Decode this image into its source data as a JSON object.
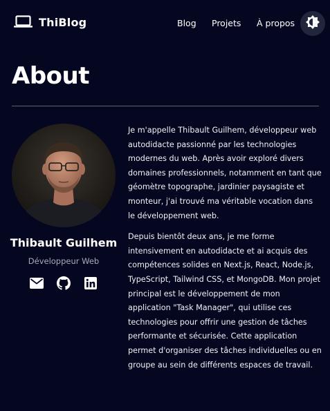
{
  "header": {
    "brand": "ThiBlog",
    "nav": [
      {
        "label": "Blog"
      },
      {
        "label": "Projets"
      },
      {
        "label": "À propos"
      }
    ]
  },
  "page": {
    "title": "About"
  },
  "profile": {
    "name": "Thibault Guilhem",
    "role": "Développeur Web"
  },
  "bio": {
    "paragraphs": [
      "Je m'appelle Thibault Guilhem, développeur web autodidacte passionné par les technologies modernes du web. Après avoir exploré divers domaines professionnels, notamment en tant que géomètre topographe, jardinier paysagiste et monteur, j'ai trouvé ma véritable vocation dans le développement web.",
      "Depuis bientôt deux ans, je me forme intensivement en autodidacte et ai acquis des compétences solides en Next.js, React, Node.js, TypeScript, Tailwind CSS, et MongoDB. Mon projet principal est le développement de mon application \"Task Manager\", qui utilise ces technologies pour offrir une gestion de tâches performante et sécurisée. Cette application permet d'organiser des tâches individuelles ou en groupe au sein de différents espaces de travail."
    ]
  },
  "theme": {
    "background": "#050720",
    "toggle_background": "#21263d",
    "divider": "#5d6275",
    "muted_text": "#a7abba"
  }
}
